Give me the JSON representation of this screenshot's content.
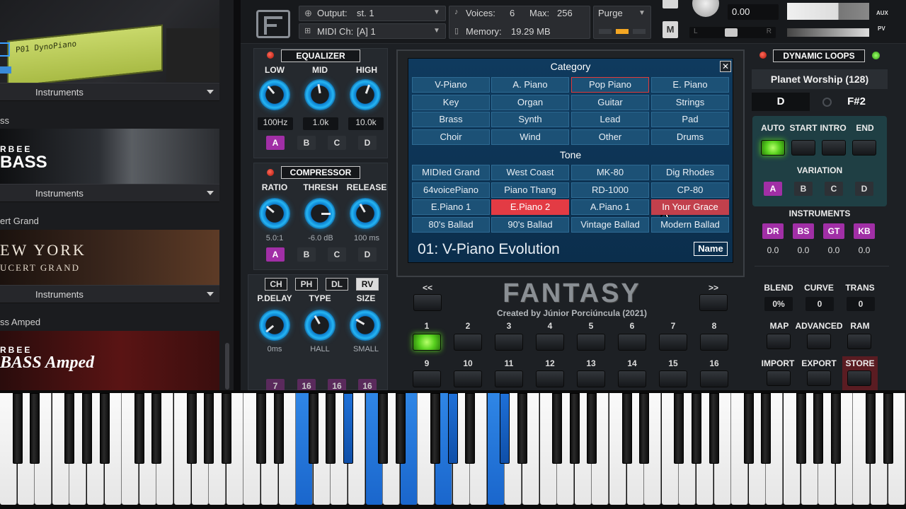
{
  "library": {
    "items": [
      {
        "name": "",
        "menu": "Instruments",
        "art_title": "P01 DynoPiano"
      },
      {
        "name": "ss",
        "menu": "Instruments",
        "art_line1": "RBEE",
        "art_line2": "BASS"
      },
      {
        "name": "ert Grand",
        "menu": "Instruments",
        "art_line1": "EW YORK",
        "art_line2": "UCERT GRAND"
      },
      {
        "name": "ss Amped",
        "menu": "Instruments",
        "art_line1": "RBEE",
        "art_line2": "BASS Amped"
      }
    ]
  },
  "header": {
    "output_label": "Output:",
    "output_value": "st. 1",
    "midi_label": "MIDI Ch:",
    "midi_value": "[A]  1",
    "voices_label": "Voices:",
    "voices_value": "6",
    "max_label": "Max:",
    "max_value": "256",
    "memory_label": "Memory:",
    "memory_value": "19.29 MB",
    "purge": "Purge",
    "tune_value": "0.00",
    "m_label": "M",
    "aux": "AUX",
    "pv": "PV",
    "pan_l": "L",
    "pan_r": "R"
  },
  "eq": {
    "title": "EQUALIZER",
    "bands": [
      {
        "label": "LOW",
        "value": "100Hz"
      },
      {
        "label": "MID",
        "value": "1.0k"
      },
      {
        "label": "HIGH",
        "value": "10.0k"
      }
    ],
    "buttons": [
      "A",
      "B",
      "C",
      "D"
    ],
    "active": "A"
  },
  "comp": {
    "title": "COMPRESSOR",
    "params": [
      {
        "label": "RATIO",
        "value": "5.0:1"
      },
      {
        "label": "THRESH",
        "value": "-6.0 dB"
      },
      {
        "label": "RELEASE",
        "value": "100 ms"
      }
    ],
    "buttons": [
      "A",
      "B",
      "C",
      "D"
    ],
    "active": "A"
  },
  "fx": {
    "tabs": [
      "CH",
      "PH",
      "DL",
      "RV"
    ],
    "active_tab": "RV",
    "params": [
      {
        "label": "P.DELAY",
        "value": "0ms"
      },
      {
        "label": "TYPE",
        "value": "HALL"
      },
      {
        "label": "SIZE",
        "value": "SMALL"
      }
    ],
    "bottom_values": [
      "7",
      "16",
      "16",
      "16"
    ]
  },
  "browser": {
    "category_title": "Category",
    "categories": [
      "V-Piano",
      "A. Piano",
      "Pop Piano",
      "E. Piano",
      "Key",
      "Organ",
      "Guitar",
      "Strings",
      "Brass",
      "Synth",
      "Lead",
      "Pad",
      "Choir",
      "Wind",
      "Other",
      "Drums"
    ],
    "selected_category": "Pop Piano",
    "tone_title": "Tone",
    "tones": [
      "MIDIed Grand",
      "West Coast",
      "MK-80",
      "Dig Rhodes",
      "64voicePiano",
      "Piano Thang",
      "RD-1000",
      "CP-80",
      "E.Piano 1",
      "E.Piano 2",
      "A.Piano 1",
      "In Your Grace",
      "80's Ballad",
      "90's Ballad",
      "Vintage Ballad",
      "Modern Ballad"
    ],
    "selected_tone": "E.Piano 2",
    "hover_tone": "In Your Grace",
    "preset": "01:  V-Piano Evolution",
    "name_button": "Name",
    "close": "✕"
  },
  "center": {
    "logo": "FANTASY",
    "credit": "Created by Júnior Porciúncula (2021)",
    "prev": "<<",
    "next": ">>",
    "pads": [
      "1",
      "2",
      "3",
      "4",
      "5",
      "6",
      "7",
      "8",
      "9",
      "10",
      "11",
      "12",
      "13",
      "14",
      "15",
      "16"
    ],
    "active_pad": "1"
  },
  "dynamic": {
    "title": "DYNAMIC LOOPS",
    "style": "Planet Worship (128)",
    "key_left": "D",
    "key_right": "F#2",
    "transport": [
      "AUTO",
      "START",
      "INTRO",
      "END"
    ],
    "variation_title": "VARIATION",
    "variations": [
      "A",
      "B",
      "C",
      "D"
    ],
    "active_variation": "A",
    "instruments_title": "INSTRUMENTS",
    "instruments": [
      {
        "label": "DR",
        "value": "0.0"
      },
      {
        "label": "BS",
        "value": "0.0"
      },
      {
        "label": "GT",
        "value": "0.0"
      },
      {
        "label": "KB",
        "value": "0.0"
      }
    ],
    "blend_label": "BLEND",
    "blend_value": "0%",
    "curve_label": "CURVE",
    "curve_value": "0",
    "trans_label": "TRANS",
    "trans_value": "0",
    "actions": [
      "MAP",
      "ADVANCED",
      "RAM",
      "IMPORT",
      "EXPORT",
      "STORE"
    ]
  },
  "colors": {
    "accent_blue": "#1c5176",
    "selected_red": "#e33b44",
    "purple": "#a12fa6",
    "led_green": "#58d11f",
    "key_blue": "#1a66cc"
  }
}
